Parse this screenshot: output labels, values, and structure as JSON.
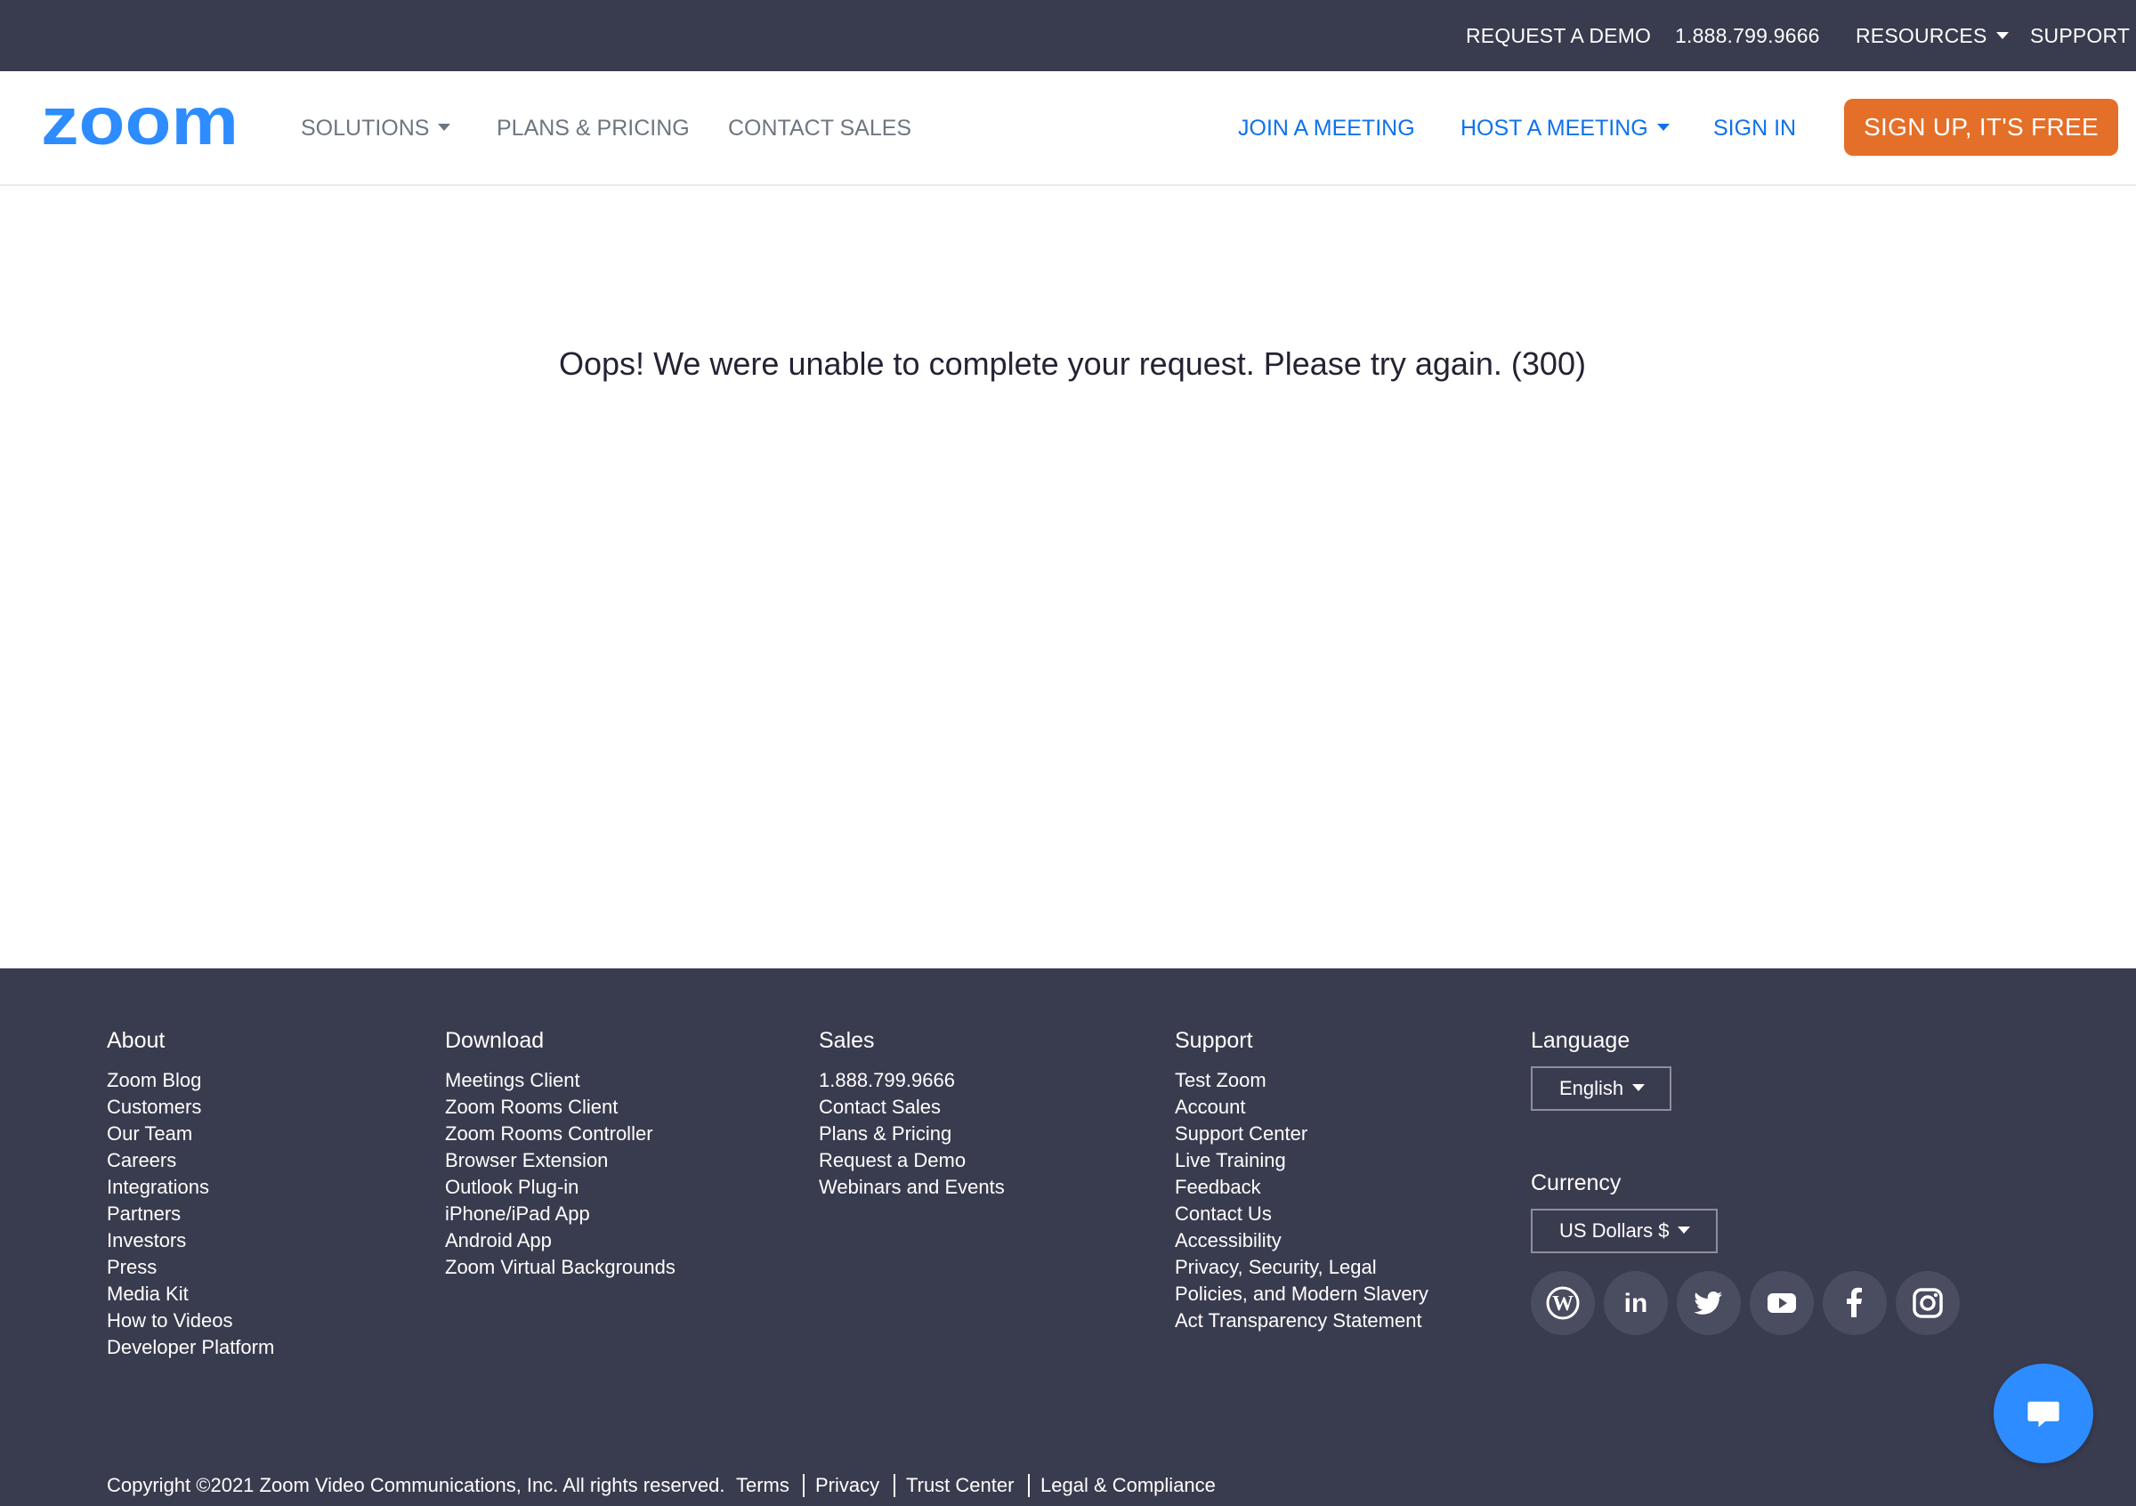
{
  "topbar": {
    "request_demo": "REQUEST A DEMO",
    "phone": "1.888.799.9666",
    "resources": "RESOURCES",
    "support": "SUPPORT"
  },
  "nav": {
    "logo_text": "zoom",
    "solutions": "SOLUTIONS",
    "plans_pricing": "PLANS & PRICING",
    "contact_sales": "CONTACT SALES",
    "join_meeting": "JOIN A MEETING",
    "host_meeting": "HOST A MEETING",
    "sign_in": "SIGN IN",
    "sign_up": "SIGN UP, IT'S FREE"
  },
  "main": {
    "error_message": "Oops! We were unable to complete your request. Please try again. (300)"
  },
  "footer": {
    "about": {
      "heading": "About",
      "items": [
        "Zoom Blog",
        "Customers",
        "Our Team",
        "Careers",
        "Integrations",
        "Partners",
        "Investors",
        "Press",
        "Media Kit",
        "How to Videos",
        "Developer Platform"
      ]
    },
    "download": {
      "heading": "Download",
      "items": [
        "Meetings Client",
        "Zoom Rooms Client",
        "Zoom Rooms Controller",
        "Browser Extension",
        "Outlook Plug-in",
        "iPhone/iPad App",
        "Android App",
        "Zoom Virtual Backgrounds"
      ]
    },
    "sales": {
      "heading": "Sales",
      "items": [
        "1.888.799.9666",
        "Contact Sales",
        "Plans & Pricing",
        "Request a Demo",
        "Webinars and Events"
      ]
    },
    "support": {
      "heading": "Support",
      "items": [
        "Test Zoom",
        "Account",
        "Support Center",
        "Live Training",
        "Feedback",
        "Contact Us",
        "Accessibility",
        "Privacy, Security, Legal",
        "Policies, and Modern Slavery",
        "Act Transparency Statement"
      ]
    },
    "language": {
      "heading": "Language",
      "value": "English"
    },
    "currency": {
      "heading": "Currency",
      "value": "US Dollars $"
    },
    "social_icons": [
      "wordpress-icon",
      "linkedin-icon",
      "twitter-icon",
      "youtube-icon",
      "facebook-icon",
      "instagram-icon"
    ],
    "copyright": "Copyright ©2021 Zoom Video Communications, Inc. All rights reserved.",
    "legal_links": {
      "terms": "Terms",
      "privacy": "Privacy",
      "trust_center": "Trust Center",
      "legal_compliance": "Legal & Compliance"
    }
  },
  "colors": {
    "dark_bar": "#393b4e",
    "zoom_blue": "#2d8cff",
    "link_blue": "#0e72ed",
    "signup_orange": "#e46f28"
  }
}
